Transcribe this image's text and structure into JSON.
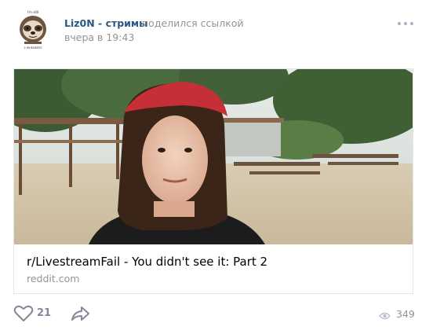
{
  "post": {
    "author": "Liz0N - стримы",
    "action": "поделился ссылкой",
    "date": "вчера в 19:43"
  },
  "avatar": {
    "top_text": "I'm still",
    "bottom_text": "2 WHENEEEE"
  },
  "link": {
    "title": "r/LivestreamFail - You didn't see it: Part 2",
    "domain": "reddit.com"
  },
  "footer": {
    "likes": "21",
    "views": "349"
  },
  "colors": {
    "accent": "#2a5885",
    "secondary": "#939393",
    "icon": "#828a99",
    "border": "#e3e4e8"
  },
  "icons": [
    "more-icon",
    "heart-icon",
    "share-icon",
    "eye-icon"
  ]
}
